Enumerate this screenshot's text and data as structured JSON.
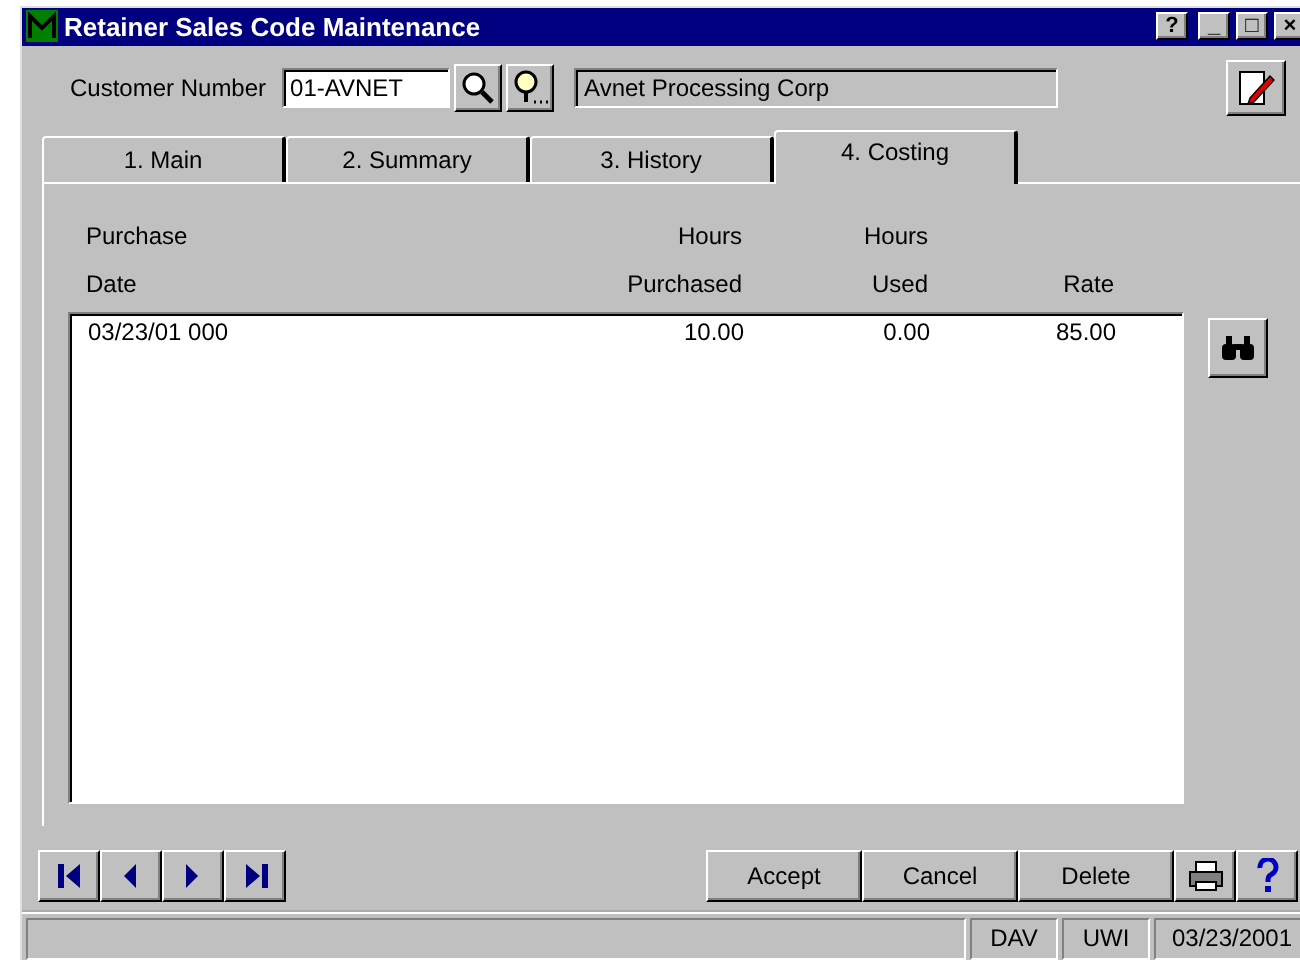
{
  "window": {
    "title": "Retainer Sales Code Maintenance",
    "controls": [
      "?",
      "_",
      "□",
      "×"
    ]
  },
  "customer": {
    "label": "Customer Number",
    "value": "01-AVNET",
    "name": "Avnet Processing Corp"
  },
  "tabs": [
    {
      "label": "1. Main",
      "selected": false
    },
    {
      "label": "2. Summary",
      "selected": false
    },
    {
      "label": "3. History",
      "selected": false
    },
    {
      "label": "4. Costing",
      "selected": true
    }
  ],
  "table": {
    "columns": [
      {
        "label": "Purchase\nDate"
      },
      {
        "label": "Hours\nPurchased"
      },
      {
        "label": "Hours\nUsed"
      },
      {
        "label": "Rate"
      }
    ],
    "rows": [
      [
        "03/23/01 000",
        "10.00",
        "0.00",
        "85.00"
      ]
    ]
  },
  "buttons": [
    "Accept",
    "Cancel",
    "Delete"
  ],
  "status_bar": [
    "DAV",
    "UWI",
    "03/23/2001"
  ]
}
